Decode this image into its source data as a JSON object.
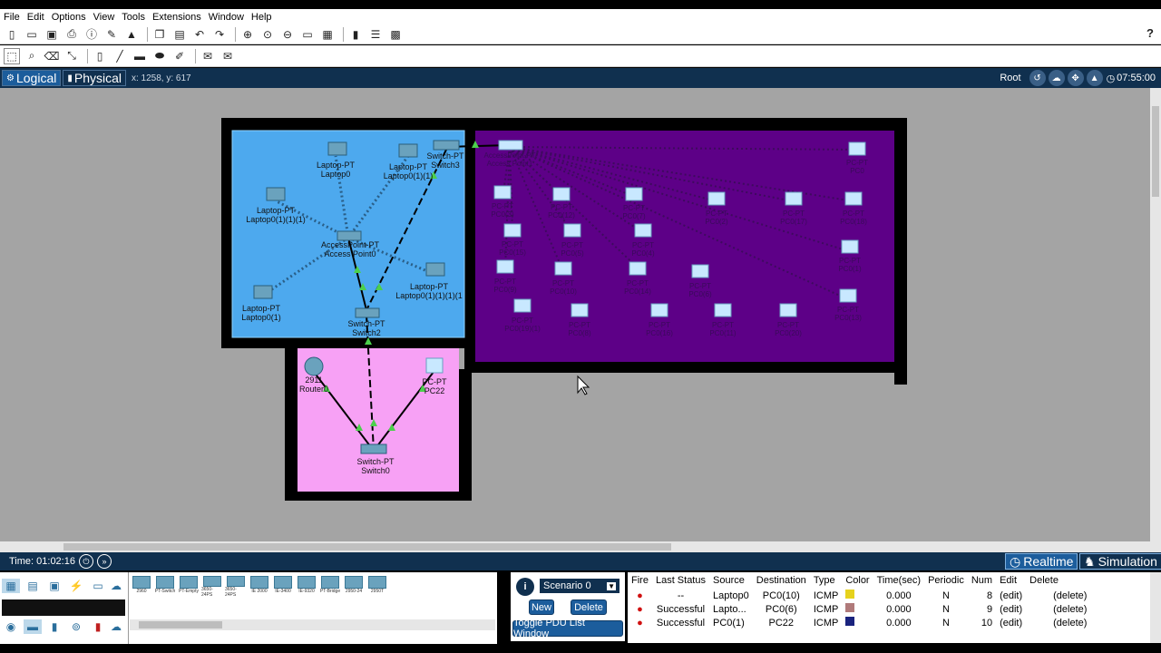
{
  "menu": [
    "File",
    "Edit",
    "Options",
    "View",
    "Tools",
    "Extensions",
    "Window",
    "Help"
  ],
  "help_label": "?",
  "views": {
    "logical": "Logical",
    "physical": "Physical"
  },
  "coords": "x: 1258, y: 617",
  "root_label": "Root",
  "clock": "07:55:00",
  "colors": {
    "blue_zone": "#4da9ee",
    "purple_zone": "#5d0087",
    "pink_zone": "#f7a1f5",
    "walls": "#000000",
    "workspace": "#a4a4a4",
    "bar": "#10304f"
  },
  "topology": {
    "blue": [
      {
        "name": "Laptop-PT",
        "sub": "Laptop0"
      },
      {
        "name": "Laptop-PT",
        "sub": "Laptop0(1)(1)"
      },
      {
        "name": "Switch-PT",
        "sub": "Switch3"
      },
      {
        "name": "Laptop-PT",
        "sub": "Laptop0(1)(1)(1)"
      },
      {
        "name": "AccessPoint-PT",
        "sub": "Access Point0"
      },
      {
        "name": "Laptop-PT",
        "sub": "Laptop0(1)(1)(1)(1"
      },
      {
        "name": "Laptop-PT",
        "sub": "Laptop0(1)"
      },
      {
        "name": "Switch-PT",
        "sub": "Switch2"
      }
    ],
    "purple": [
      {
        "name": "AccessPoint-PT",
        "sub": "Access Point1"
      },
      {
        "name": "PC-PT",
        "sub": "PC0"
      },
      {
        "name": "PC-PT",
        "sub": "PC0(3)"
      },
      {
        "name": "PC-PT",
        "sub": "PC0(12)"
      },
      {
        "name": "PC-PT",
        "sub": "PC0(7)"
      },
      {
        "name": "PC-PT",
        "sub": "PC0(2)"
      },
      {
        "name": "PC-PT",
        "sub": "PC0(17)"
      },
      {
        "name": "PC-PT",
        "sub": "PC0(18)"
      },
      {
        "name": "PC-PT",
        "sub": "PC0(15)"
      },
      {
        "name": "PC-PT",
        "sub": "PC0(5)"
      },
      {
        "name": "PC-PT",
        "sub": "PC0(4)"
      },
      {
        "name": "PC-PT",
        "sub": "PC0(1)"
      },
      {
        "name": "PC-PT",
        "sub": "PC0(9)"
      },
      {
        "name": "PC-PT",
        "sub": "PC0(10)"
      },
      {
        "name": "PC-PT",
        "sub": "PC0(14)"
      },
      {
        "name": "PC-PT",
        "sub": "PC0(6)"
      },
      {
        "name": "PC-PT",
        "sub": "PC0(13)"
      },
      {
        "name": "PC-PT",
        "sub": "PC0(19)(1)"
      },
      {
        "name": "PC-PT",
        "sub": "PC0(8)"
      },
      {
        "name": "PC-PT",
        "sub": "PC0(16)"
      },
      {
        "name": "PC-PT",
        "sub": "PC0(11)"
      },
      {
        "name": "PC-PT",
        "sub": "PC0(20)"
      }
    ],
    "pink": [
      {
        "name": "2911",
        "sub": "Router0"
      },
      {
        "name": "PC-PT",
        "sub": "PC22"
      },
      {
        "name": "Switch-PT",
        "sub": "Switch0"
      }
    ]
  },
  "status": {
    "time": "Time: 01:02:16",
    "realtime": "Realtime",
    "simulation": "Simulation"
  },
  "devices": [
    "2960",
    "PT-Switch",
    "PT-Empty",
    "3650-24PS",
    "3650-24PS",
    "IE 2000",
    "IE-3400",
    "IE-9320",
    "PT-Bridge",
    "2950-24",
    "2950T"
  ],
  "scenario": {
    "selected": "Scenario 0",
    "new": "New",
    "delete": "Delete",
    "toggle": "Toggle PDU List Window"
  },
  "pdu": {
    "headers": [
      "Fire",
      "Last Status",
      "Source",
      "Destination",
      "Type",
      "Color",
      "Time(sec)",
      "Periodic",
      "Num",
      "Edit",
      "Delete"
    ],
    "rows": [
      {
        "status": "--",
        "source": "Laptop0",
        "dest": "PC0(10)",
        "type": "ICMP",
        "color": "#e6d21d",
        "time": "0.000",
        "periodic": "N",
        "num": "8",
        "edit": "(edit)",
        "delete": "(delete)"
      },
      {
        "status": "Successful",
        "source": "Lapto...",
        "dest": "PC0(6)",
        "type": "ICMP",
        "color": "#b07a7a",
        "time": "0.000",
        "periodic": "N",
        "num": "9",
        "edit": "(edit)",
        "delete": "(delete)"
      },
      {
        "status": "Successful",
        "source": "PC0(1)",
        "dest": "PC22",
        "type": "ICMP",
        "color": "#1a237e",
        "time": "0.000",
        "periodic": "N",
        "num": "10",
        "edit": "(edit)",
        "delete": "(delete)"
      }
    ]
  }
}
